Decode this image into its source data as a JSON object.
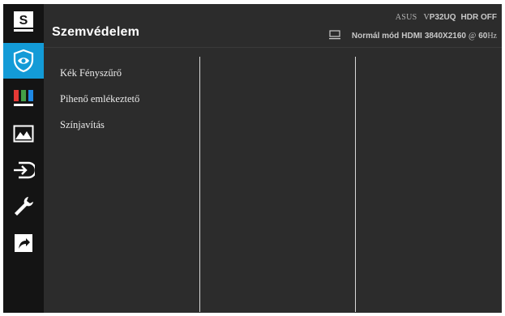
{
  "sidebar": {
    "items": [
      {
        "name": "splendid-icon",
        "label": "S"
      },
      {
        "name": "eye-care-icon"
      },
      {
        "name": "color-icon"
      },
      {
        "name": "image-icon"
      },
      {
        "name": "input-select-icon"
      },
      {
        "name": "system-setup-icon"
      },
      {
        "name": "shortcut-icon"
      }
    ],
    "active_color": "#139bd7"
  },
  "header": {
    "title": "Szemvédelem",
    "brand": "ASUS",
    "model_prefix": "V",
    "model": "P32UQ",
    "hdr": "HDR OFF",
    "mode": "Normál mód",
    "input": "HDMI",
    "resolution": "3840X2160",
    "at": "@",
    "refresh_value": "60",
    "refresh_unit": "Hz",
    "monitor_icon": "monitor-icon"
  },
  "menu": {
    "items": [
      "Kék Fényszűrő",
      "Pihenő emlékeztető",
      "Színjavítás"
    ]
  }
}
